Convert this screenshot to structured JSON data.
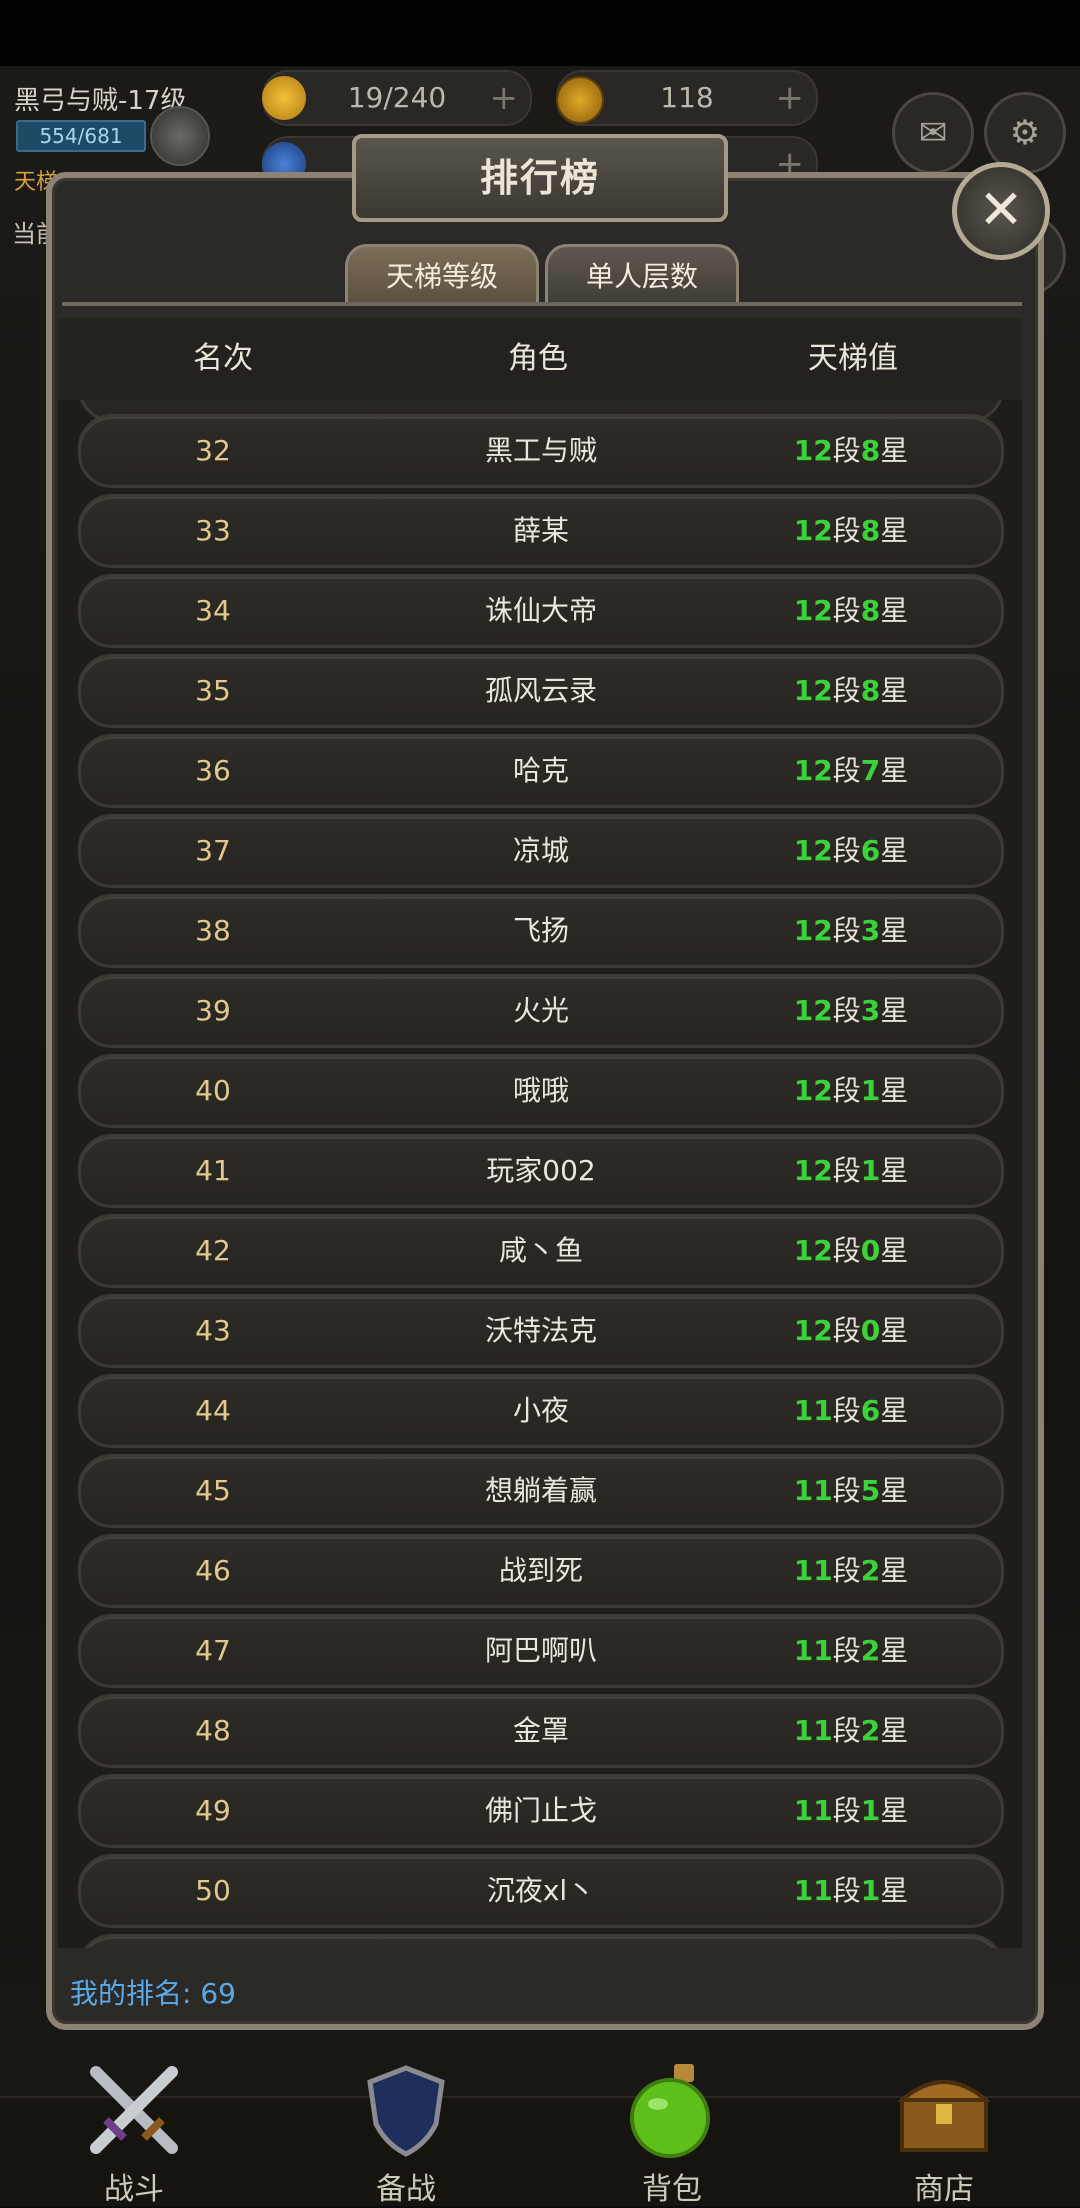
{
  "player": {
    "name": "黑弓与贼-17级",
    "xp": "554/681",
    "ladder_tag": "天梯",
    "side_text": "当前"
  },
  "resources": {
    "energy": "19/240",
    "coins": "118",
    "plus": "+"
  },
  "dialog": {
    "title": "排行榜",
    "close": "✕",
    "tabs": {
      "ladder": "天梯等级",
      "floor": "单人层数"
    },
    "columns": {
      "rank": "名次",
      "role": "角色",
      "score": "天梯值"
    },
    "units": {
      "segment": "段",
      "star": "星"
    },
    "rows": [
      {
        "rank": "32",
        "name": "黑工与贼",
        "seg": "12",
        "star": "8"
      },
      {
        "rank": "33",
        "name": "薛某",
        "seg": "12",
        "star": "8"
      },
      {
        "rank": "34",
        "name": "诛仙大帝",
        "seg": "12",
        "star": "8"
      },
      {
        "rank": "35",
        "name": "孤风云录",
        "seg": "12",
        "star": "8"
      },
      {
        "rank": "36",
        "name": "哈克",
        "seg": "12",
        "star": "7"
      },
      {
        "rank": "37",
        "name": "凉城",
        "seg": "12",
        "star": "6"
      },
      {
        "rank": "38",
        "name": "飞扬",
        "seg": "12",
        "star": "3"
      },
      {
        "rank": "39",
        "name": "火光",
        "seg": "12",
        "star": "3"
      },
      {
        "rank": "40",
        "name": "哦哦",
        "seg": "12",
        "star": "1"
      },
      {
        "rank": "41",
        "name": "玩家002",
        "seg": "12",
        "star": "1"
      },
      {
        "rank": "42",
        "name": "咸丶鱼",
        "seg": "12",
        "star": "0"
      },
      {
        "rank": "43",
        "name": "沃特法克",
        "seg": "12",
        "star": "0"
      },
      {
        "rank": "44",
        "name": "小夜",
        "seg": "11",
        "star": "6"
      },
      {
        "rank": "45",
        "name": "想躺着赢",
        "seg": "11",
        "star": "5"
      },
      {
        "rank": "46",
        "name": "战到死",
        "seg": "11",
        "star": "2"
      },
      {
        "rank": "47",
        "name": "阿巴啊叭",
        "seg": "11",
        "star": "2"
      },
      {
        "rank": "48",
        "name": "金罩",
        "seg": "11",
        "star": "2"
      },
      {
        "rank": "49",
        "name": "佛门止戈",
        "seg": "11",
        "star": "1"
      },
      {
        "rank": "50",
        "name": "沉夜xl丶",
        "seg": "11",
        "star": "1"
      }
    ],
    "my_rank": "我的排名: 69"
  },
  "nav": {
    "fight": "战斗",
    "prep": "备战",
    "bag": "背包",
    "shop": "商店"
  },
  "icons": {
    "energy": "lightning-icon",
    "coin": "coin-icon",
    "gem": "gem-icon",
    "mail": "mail-icon",
    "settings": "gear-icon"
  },
  "colors": {
    "score_number": "#3ad43a",
    "my_rank": "#5aa8e6",
    "rank_text": "#e3c88e"
  }
}
